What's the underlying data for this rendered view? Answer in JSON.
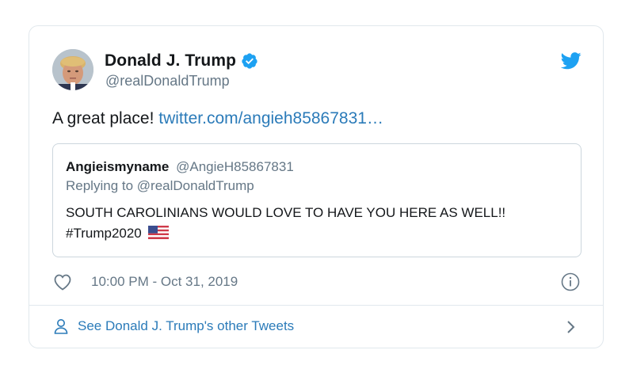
{
  "author": {
    "display_name": "Donald J. Trump",
    "handle": "@realDonaldTrump",
    "verified": true
  },
  "tweet": {
    "text": "A great place! ",
    "link_text": "twitter.com/angieh85867831…"
  },
  "quoted_tweet": {
    "display_name": "Angieismyname",
    "handle": "@AngieH85867831",
    "replying_to": "Replying to @realDonaldTrump",
    "text": "SOUTH CAROLINIANS WOULD LOVE TO HAVE YOU HERE AS WELL!!  #Trump2020 ",
    "flag_icon": "us-flag-icon"
  },
  "meta": {
    "timestamp": "10:00 PM - Oct 31, 2019"
  },
  "footer": {
    "link_text": "See Donald J. Trump's other Tweets"
  },
  "colors": {
    "link": "#2b7bb9",
    "verified": "#1da1f2",
    "muted": "#657786",
    "border": "#e1e8ed"
  },
  "icons": [
    "avatar",
    "verified-badge-icon",
    "twitter-bird-icon",
    "us-flag-icon",
    "heart-icon",
    "info-icon",
    "person-icon",
    "chevron-right-icon"
  ]
}
